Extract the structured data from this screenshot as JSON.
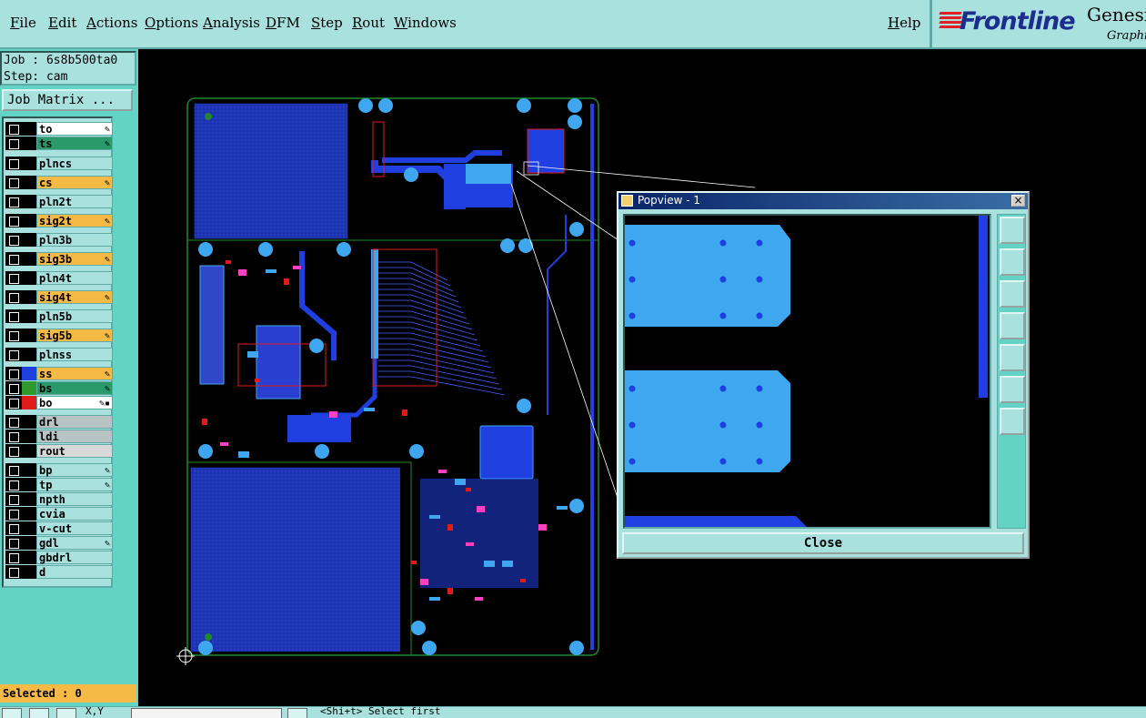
{
  "menu": {
    "items": [
      "File",
      "Edit",
      "Actions",
      "Options",
      "Analysis",
      "DFM",
      "Step",
      "Rout",
      "Windows"
    ],
    "help": "Help"
  },
  "logo": {
    "name": "Frontline",
    "brand": "Genesis",
    "sub": "Graphic"
  },
  "job": {
    "job_line": "Job : 6s8b500ta0",
    "step_line": "Step: cam",
    "matrix_button": "Job Matrix ..."
  },
  "layers": [
    {
      "name": "to",
      "color": "#ffffff",
      "swatch": "#000000",
      "flag": "✎"
    },
    {
      "name": "ts",
      "color": "#2a9a6a",
      "swatch": "#000000",
      "flag": "✎"
    },
    {
      "name": "plncs",
      "color": "#a9e1df",
      "swatch": "#000000",
      "flag": ""
    },
    {
      "name": "cs",
      "color": "#f5b945",
      "swatch": "#000000",
      "flag": "✎"
    },
    {
      "name": "pln2t",
      "color": "#a9e1df",
      "swatch": "#000000",
      "flag": ""
    },
    {
      "name": "sig2t",
      "color": "#f5b945",
      "swatch": "#000000",
      "flag": "✎"
    },
    {
      "name": "pln3b",
      "color": "#a9e1df",
      "swatch": "#000000",
      "flag": ""
    },
    {
      "name": "sig3b",
      "color": "#f5b945",
      "swatch": "#000000",
      "flag": "✎"
    },
    {
      "name": "pln4t",
      "color": "#a9e1df",
      "swatch": "#000000",
      "flag": ""
    },
    {
      "name": "sig4t",
      "color": "#f5b945",
      "swatch": "#000000",
      "flag": "✎"
    },
    {
      "name": "pln5b",
      "color": "#a9e1df",
      "swatch": "#000000",
      "flag": ""
    },
    {
      "name": "sig5b",
      "color": "#f5b945",
      "swatch": "#000000",
      "flag": "✎"
    },
    {
      "name": "plnss",
      "color": "#a9e1df",
      "swatch": "#000000",
      "flag": ""
    },
    {
      "name": "ss",
      "color": "#f5b945",
      "swatch": "#1f3fe0",
      "flag": "✎"
    },
    {
      "name": "bs",
      "color": "#2a9a6a",
      "swatch": "#2e9a2e",
      "flag": "✎"
    },
    {
      "name": "bo",
      "color": "#ffffff",
      "swatch": "#e11a1a",
      "flag": "✎▪"
    },
    {
      "name": "drl",
      "color": "#b8c4c4",
      "swatch": "#000000",
      "flag": ""
    },
    {
      "name": "ldi",
      "color": "#b8c4c4",
      "swatch": "#000000",
      "flag": ""
    },
    {
      "name": "rout",
      "color": "#d8d8d8",
      "swatch": "#000000",
      "flag": ""
    },
    {
      "name": "bp",
      "color": "#a9e1df",
      "swatch": "#000000",
      "flag": "✎"
    },
    {
      "name": "tp",
      "color": "#a9e1df",
      "swatch": "#000000",
      "flag": "✎"
    },
    {
      "name": "npth",
      "color": "#a9e1df",
      "swatch": "#000000",
      "flag": ""
    },
    {
      "name": "cvia",
      "color": "#a9e1df",
      "swatch": "#000000",
      "flag": ""
    },
    {
      "name": "v-cut",
      "color": "#a9e1df",
      "swatch": "#000000",
      "flag": ""
    },
    {
      "name": "gdl",
      "color": "#a9e1df",
      "swatch": "#000000",
      "flag": "✎"
    },
    {
      "name": "gbdrl",
      "color": "#a9e1df",
      "swatch": "#000000",
      "flag": ""
    },
    {
      "name": "d",
      "color": "#a9e1df",
      "swatch": "#000000",
      "flag": ""
    }
  ],
  "selected": "Selected : 0",
  "status": {
    "xy": "X,Y",
    "message": "<Shi+t> Select first"
  },
  "popview": {
    "title": "Popview - 1",
    "close_x": "×",
    "close_button": "Close"
  },
  "colors": {
    "panel": "#a9e1df",
    "panel_dark": "#62d3c4",
    "trace": "#1f3fe0",
    "pad": "#3fa7f0",
    "outline": "#1f8a2a",
    "annot": "#e11a1a"
  },
  "icons": [
    "zoom-window-icon",
    "pan-up-icon",
    "pan-down-icon",
    "pan-left-icon",
    "pan-right-icon",
    "zoom-fit-icon",
    "zoom-home-icon"
  ]
}
